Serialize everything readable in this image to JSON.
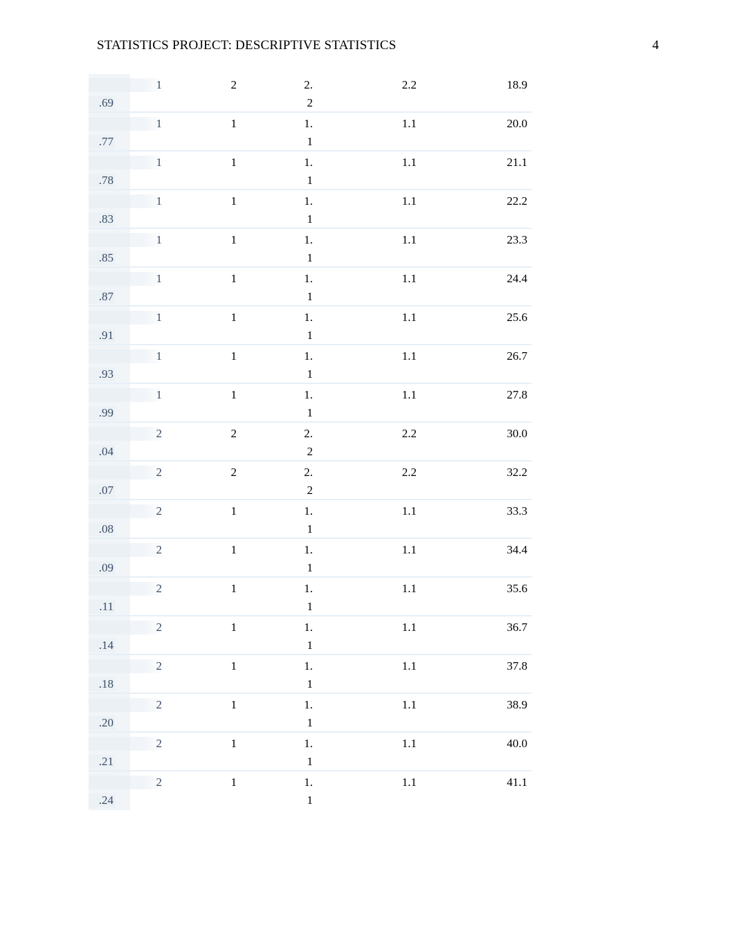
{
  "header": {
    "running_head": "STATISTICS PROJECT: DESCRIPTIVE STATISTICS",
    "page_number": "4"
  },
  "table": {
    "rows": [
      {
        "c1_top": "1",
        "c1_bot": ".69",
        "c2": "2",
        "c3_top": "2.",
        "c3_bot": "2",
        "c4": "2.2",
        "c5": "18.9"
      },
      {
        "c1_top": "1",
        "c1_bot": ".77",
        "c2": "1",
        "c3_top": "1.",
        "c3_bot": "1",
        "c4": "1.1",
        "c5": "20.0"
      },
      {
        "c1_top": "1",
        "c1_bot": ".78",
        "c2": "1",
        "c3_top": "1.",
        "c3_bot": "1",
        "c4": "1.1",
        "c5": "21.1"
      },
      {
        "c1_top": "1",
        "c1_bot": ".83",
        "c2": "1",
        "c3_top": "1.",
        "c3_bot": "1",
        "c4": "1.1",
        "c5": "22.2"
      },
      {
        "c1_top": "1",
        "c1_bot": ".85",
        "c2": "1",
        "c3_top": "1.",
        "c3_bot": "1",
        "c4": "1.1",
        "c5": "23.3"
      },
      {
        "c1_top": "1",
        "c1_bot": ".87",
        "c2": "1",
        "c3_top": "1.",
        "c3_bot": "1",
        "c4": "1.1",
        "c5": "24.4"
      },
      {
        "c1_top": "1",
        "c1_bot": ".91",
        "c2": "1",
        "c3_top": "1.",
        "c3_bot": "1",
        "c4": "1.1",
        "c5": "25.6"
      },
      {
        "c1_top": "1",
        "c1_bot": ".93",
        "c2": "1",
        "c3_top": "1.",
        "c3_bot": "1",
        "c4": "1.1",
        "c5": "26.7"
      },
      {
        "c1_top": "1",
        "c1_bot": ".99",
        "c2": "1",
        "c3_top": "1.",
        "c3_bot": "1",
        "c4": "1.1",
        "c5": "27.8"
      },
      {
        "c1_top": "2",
        "c1_bot": ".04",
        "c2": "2",
        "c3_top": "2.",
        "c3_bot": "2",
        "c4": "2.2",
        "c5": "30.0"
      },
      {
        "c1_top": "2",
        "c1_bot": ".07",
        "c2": "2",
        "c3_top": "2.",
        "c3_bot": "2",
        "c4": "2.2",
        "c5": "32.2"
      },
      {
        "c1_top": "2",
        "c1_bot": ".08",
        "c2": "1",
        "c3_top": "1.",
        "c3_bot": "1",
        "c4": "1.1",
        "c5": "33.3"
      },
      {
        "c1_top": "2",
        "c1_bot": ".09",
        "c2": "1",
        "c3_top": "1.",
        "c3_bot": "1",
        "c4": "1.1",
        "c5": "34.4"
      },
      {
        "c1_top": "2",
        "c1_bot": ".11",
        "c2": "1",
        "c3_top": "1.",
        "c3_bot": "1",
        "c4": "1.1",
        "c5": "35.6"
      },
      {
        "c1_top": "2",
        "c1_bot": ".14",
        "c2": "1",
        "c3_top": "1.",
        "c3_bot": "1",
        "c4": "1.1",
        "c5": "36.7"
      },
      {
        "c1_top": "2",
        "c1_bot": ".18",
        "c2": "1",
        "c3_top": "1.",
        "c3_bot": "1",
        "c4": "1.1",
        "c5": "37.8"
      },
      {
        "c1_top": "2",
        "c1_bot": ".20",
        "c2": "1",
        "c3_top": "1.",
        "c3_bot": "1",
        "c4": "1.1",
        "c5": "38.9"
      },
      {
        "c1_top": "2",
        "c1_bot": ".21",
        "c2": "1",
        "c3_top": "1.",
        "c3_bot": "1",
        "c4": "1.1",
        "c5": "40.0"
      },
      {
        "c1_top": "2",
        "c1_bot": ".24",
        "c2": "1",
        "c3_top": "1.",
        "c3_bot": "1",
        "c4": "1.1",
        "c5": "41.1"
      }
    ]
  }
}
